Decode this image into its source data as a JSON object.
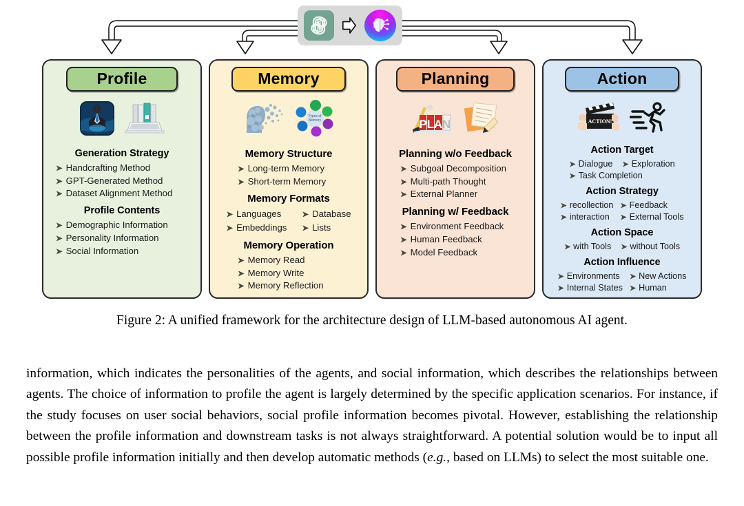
{
  "figure": {
    "logo": {
      "openai_icon": "openai-logo-icon",
      "arrow_icon": "right-arrow-icon",
      "brain_icon": "ai-brain-icon"
    },
    "panels": [
      {
        "id": "profile",
        "title": "Profile",
        "header_color": "#a9d18e",
        "panel_color": "#e7f1de",
        "icons": [
          "businessman-photo-icon",
          "laptop-binders-icon"
        ],
        "sections": [
          {
            "title": "Generation Strategy",
            "layout": "list",
            "items": [
              "Handcrafting Method",
              "GPT-Generated  Method",
              "Dataset  Alignment Method"
            ]
          },
          {
            "title": "Profile Contents",
            "layout": "list",
            "items": [
              "Demographic  Information",
              "Personality Information",
              "Social Information"
            ]
          }
        ]
      },
      {
        "id": "memory",
        "title": "Memory",
        "header_color": "#fdd366",
        "panel_color": "#fdf1d4",
        "icons": [
          "dispersing-head-icon",
          "types-of-memory-diagram-icon"
        ],
        "sections": [
          {
            "title": "Memory Structure",
            "layout": "list-indent",
            "items": [
              "Long-term Memory",
              "Short-term Memory"
            ]
          },
          {
            "title": "Memory Formats",
            "layout": "grid2",
            "items": [
              "Languages",
              "Database",
              "Embeddings",
              "Lists"
            ]
          },
          {
            "title": "Memory Operation",
            "layout": "list-indent",
            "items": [
              "Memory Read",
              "Memory Write",
              "Memory Reflection"
            ]
          }
        ]
      },
      {
        "id": "planning",
        "title": "Planning",
        "header_color": "#f4b183",
        "panel_color": "#fae4d5",
        "icons": [
          "plan-blocks-icon",
          "notes-pencil-icon"
        ],
        "sections": [
          {
            "title": "Planning w/o Feedback",
            "layout": "list-indent",
            "items": [
              "Subgoal Decomposition",
              "Multi-path Thought",
              "External Planner"
            ]
          },
          {
            "title": "Planning w/ Feedback",
            "layout": "list-indent",
            "items": [
              "Environment Feedback",
              "Human Feedback",
              "Model Feedback"
            ]
          }
        ]
      },
      {
        "id": "action",
        "title": "Action",
        "header_color": "#9cc3e5",
        "panel_color": "#dbe8f6",
        "icons": [
          "clapperboard-action-icon",
          "running-person-icon"
        ],
        "sections": [
          {
            "title": "Action Target",
            "layout": "grid2",
            "items": [
              "Dialogue",
              "Exploration",
              "Task Completion"
            ]
          },
          {
            "title": "Action Strategy",
            "layout": "grid2",
            "items": [
              "recollection",
              "Feedback",
              "interaction",
              "External Tools"
            ]
          },
          {
            "title": "Action Space",
            "layout": "grid2",
            "items": [
              "with Tools",
              "without Tools"
            ]
          },
          {
            "title": "Action Influence",
            "layout": "grid2",
            "items": [
              "Environments",
              "New Actions",
              "Internal States",
              "Human"
            ]
          }
        ]
      }
    ],
    "caption": "Figure 2: A unified framework for the architecture design of LLM-based autonomous AI agent."
  },
  "body": {
    "part1": "information, which indicates the personalities of the agents, and social information, which describes the relationships between agents. The choice of information to profile the agent is largely determined by the specific application scenarios. For instance, if the study focuses on user social behaviors, social profile information becomes pivotal. However, establishing the relationship between the profile information and downstream tasks is not always straightforward. A potential solution would be to input all possible profile information initially and then develop automatic methods (",
    "italic": "e.g.",
    "part2": ", based on LLMs) to select the most suitable one."
  }
}
